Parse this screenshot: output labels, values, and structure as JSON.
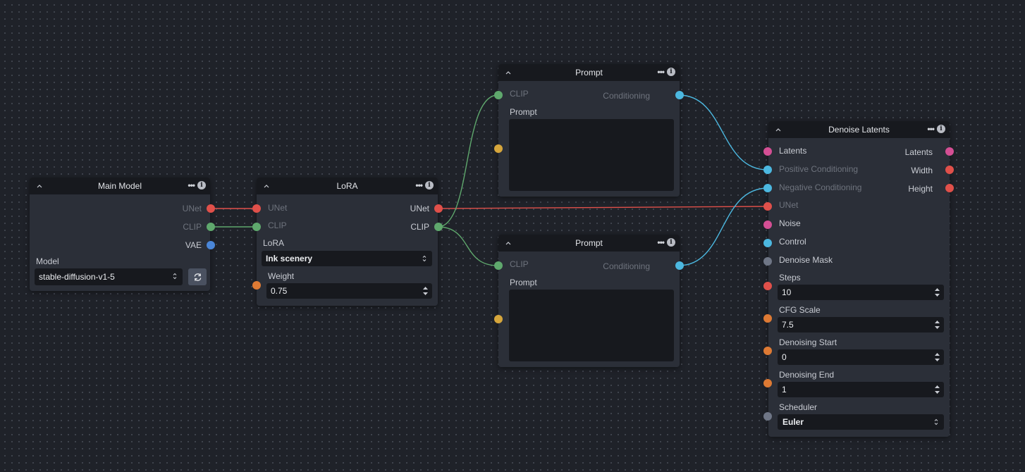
{
  "colors": {
    "unet": "#e0504a",
    "clip": "#5fa86d",
    "vae": "#4a86d8",
    "conditioning": "#4cb8e0",
    "number": "#de7a34",
    "string": "#d6a63c",
    "latents": "#d44f94",
    "scheduler": "#6f7686",
    "noise": "#d44f94",
    "mask": "#6f7686"
  },
  "main_model": {
    "title": "Main Model",
    "outputs": {
      "unet": "UNet",
      "clip": "CLIP",
      "vae": "VAE"
    },
    "model_label": "Model",
    "model_value": "stable-diffusion-v1-5"
  },
  "lora": {
    "title": "LoRA",
    "inputs": {
      "unet": "UNet",
      "clip": "CLIP"
    },
    "outputs": {
      "unet": "UNet",
      "clip": "CLIP"
    },
    "lora_label": "LoRA",
    "lora_value": "Ink scenery",
    "weight_label": "Weight",
    "weight_value": "0.75"
  },
  "prompt_top": {
    "title": "Prompt",
    "input_clip": "CLIP",
    "output_conditioning": "Conditioning",
    "prompt_label": "Prompt",
    "prompt_value": ""
  },
  "prompt_bottom": {
    "title": "Prompt",
    "input_clip": "CLIP",
    "output_conditioning": "Conditioning",
    "prompt_label": "Prompt",
    "prompt_value": ""
  },
  "denoise": {
    "title": "Denoise Latents",
    "inputs": {
      "latents": "Latents",
      "positive": "Positive Conditioning",
      "negative": "Negative Conditioning",
      "unet": "UNet",
      "noise": "Noise",
      "control": "Control",
      "mask": "Denoise Mask"
    },
    "outputs": {
      "latents": "Latents",
      "width": "Width",
      "height": "Height"
    },
    "steps_label": "Steps",
    "steps_value": "10",
    "cfg_label": "CFG Scale",
    "cfg_value": "7.5",
    "start_label": "Denoising Start",
    "start_value": "0",
    "end_label": "Denoising End",
    "end_value": "1",
    "scheduler_label": "Scheduler",
    "scheduler_value": "Euler"
  }
}
